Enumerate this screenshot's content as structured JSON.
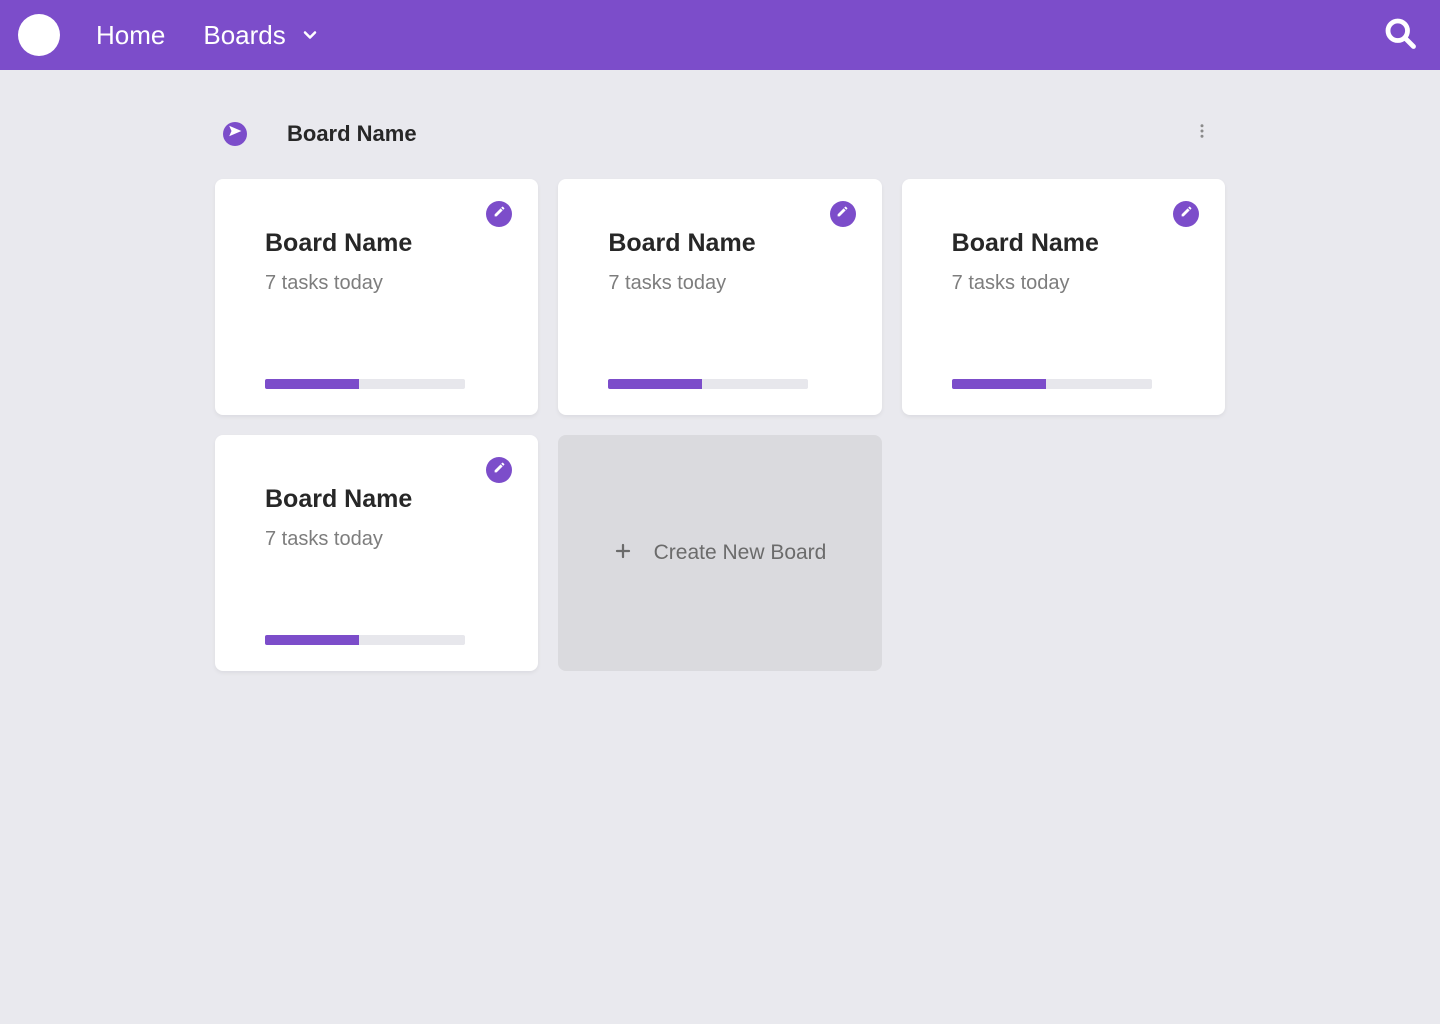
{
  "colors": {
    "primary": "#7c4dca"
  },
  "nav": {
    "home": "Home",
    "boards": "Boards"
  },
  "page": {
    "title": "Board Name"
  },
  "cards": [
    {
      "title": "Board Name",
      "subtitle": "7 tasks today",
      "progress": 47
    },
    {
      "title": "Board Name",
      "subtitle": "7 tasks today",
      "progress": 47
    },
    {
      "title": "Board Name",
      "subtitle": "7 tasks today",
      "progress": 47
    },
    {
      "title": "Board Name",
      "subtitle": "7 tasks today",
      "progress": 47
    }
  ],
  "new_card": {
    "label": "Create New Board"
  }
}
